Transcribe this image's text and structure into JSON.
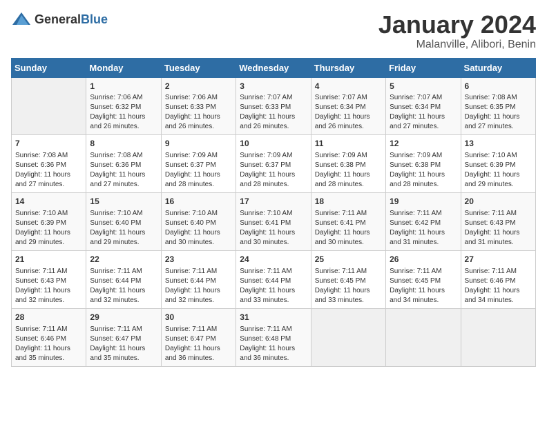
{
  "logo": {
    "general": "General",
    "blue": "Blue"
  },
  "header": {
    "title": "January 2024",
    "subtitle": "Malanville, Alibori, Benin"
  },
  "weekdays": [
    "Sunday",
    "Monday",
    "Tuesday",
    "Wednesday",
    "Thursday",
    "Friday",
    "Saturday"
  ],
  "weeks": [
    [
      {
        "day": "",
        "info": ""
      },
      {
        "day": "1",
        "info": "Sunrise: 7:06 AM\nSunset: 6:32 PM\nDaylight: 11 hours and 26 minutes."
      },
      {
        "day": "2",
        "info": "Sunrise: 7:06 AM\nSunset: 6:33 PM\nDaylight: 11 hours and 26 minutes."
      },
      {
        "day": "3",
        "info": "Sunrise: 7:07 AM\nSunset: 6:33 PM\nDaylight: 11 hours and 26 minutes."
      },
      {
        "day": "4",
        "info": "Sunrise: 7:07 AM\nSunset: 6:34 PM\nDaylight: 11 hours and 26 minutes."
      },
      {
        "day": "5",
        "info": "Sunrise: 7:07 AM\nSunset: 6:34 PM\nDaylight: 11 hours and 27 minutes."
      },
      {
        "day": "6",
        "info": "Sunrise: 7:08 AM\nSunset: 6:35 PM\nDaylight: 11 hours and 27 minutes."
      }
    ],
    [
      {
        "day": "7",
        "info": "Sunrise: 7:08 AM\nSunset: 6:36 PM\nDaylight: 11 hours and 27 minutes."
      },
      {
        "day": "8",
        "info": "Sunrise: 7:08 AM\nSunset: 6:36 PM\nDaylight: 11 hours and 27 minutes."
      },
      {
        "day": "9",
        "info": "Sunrise: 7:09 AM\nSunset: 6:37 PM\nDaylight: 11 hours and 28 minutes."
      },
      {
        "day": "10",
        "info": "Sunrise: 7:09 AM\nSunset: 6:37 PM\nDaylight: 11 hours and 28 minutes."
      },
      {
        "day": "11",
        "info": "Sunrise: 7:09 AM\nSunset: 6:38 PM\nDaylight: 11 hours and 28 minutes."
      },
      {
        "day": "12",
        "info": "Sunrise: 7:09 AM\nSunset: 6:38 PM\nDaylight: 11 hours and 28 minutes."
      },
      {
        "day": "13",
        "info": "Sunrise: 7:10 AM\nSunset: 6:39 PM\nDaylight: 11 hours and 29 minutes."
      }
    ],
    [
      {
        "day": "14",
        "info": "Sunrise: 7:10 AM\nSunset: 6:39 PM\nDaylight: 11 hours and 29 minutes."
      },
      {
        "day": "15",
        "info": "Sunrise: 7:10 AM\nSunset: 6:40 PM\nDaylight: 11 hours and 29 minutes."
      },
      {
        "day": "16",
        "info": "Sunrise: 7:10 AM\nSunset: 6:40 PM\nDaylight: 11 hours and 30 minutes."
      },
      {
        "day": "17",
        "info": "Sunrise: 7:10 AM\nSunset: 6:41 PM\nDaylight: 11 hours and 30 minutes."
      },
      {
        "day": "18",
        "info": "Sunrise: 7:11 AM\nSunset: 6:41 PM\nDaylight: 11 hours and 30 minutes."
      },
      {
        "day": "19",
        "info": "Sunrise: 7:11 AM\nSunset: 6:42 PM\nDaylight: 11 hours and 31 minutes."
      },
      {
        "day": "20",
        "info": "Sunrise: 7:11 AM\nSunset: 6:43 PM\nDaylight: 11 hours and 31 minutes."
      }
    ],
    [
      {
        "day": "21",
        "info": "Sunrise: 7:11 AM\nSunset: 6:43 PM\nDaylight: 11 hours and 32 minutes."
      },
      {
        "day": "22",
        "info": "Sunrise: 7:11 AM\nSunset: 6:44 PM\nDaylight: 11 hours and 32 minutes."
      },
      {
        "day": "23",
        "info": "Sunrise: 7:11 AM\nSunset: 6:44 PM\nDaylight: 11 hours and 32 minutes."
      },
      {
        "day": "24",
        "info": "Sunrise: 7:11 AM\nSunset: 6:44 PM\nDaylight: 11 hours and 33 minutes."
      },
      {
        "day": "25",
        "info": "Sunrise: 7:11 AM\nSunset: 6:45 PM\nDaylight: 11 hours and 33 minutes."
      },
      {
        "day": "26",
        "info": "Sunrise: 7:11 AM\nSunset: 6:45 PM\nDaylight: 11 hours and 34 minutes."
      },
      {
        "day": "27",
        "info": "Sunrise: 7:11 AM\nSunset: 6:46 PM\nDaylight: 11 hours and 34 minutes."
      }
    ],
    [
      {
        "day": "28",
        "info": "Sunrise: 7:11 AM\nSunset: 6:46 PM\nDaylight: 11 hours and 35 minutes."
      },
      {
        "day": "29",
        "info": "Sunrise: 7:11 AM\nSunset: 6:47 PM\nDaylight: 11 hours and 35 minutes."
      },
      {
        "day": "30",
        "info": "Sunrise: 7:11 AM\nSunset: 6:47 PM\nDaylight: 11 hours and 36 minutes."
      },
      {
        "day": "31",
        "info": "Sunrise: 7:11 AM\nSunset: 6:48 PM\nDaylight: 11 hours and 36 minutes."
      },
      {
        "day": "",
        "info": ""
      },
      {
        "day": "",
        "info": ""
      },
      {
        "day": "",
        "info": ""
      }
    ]
  ]
}
